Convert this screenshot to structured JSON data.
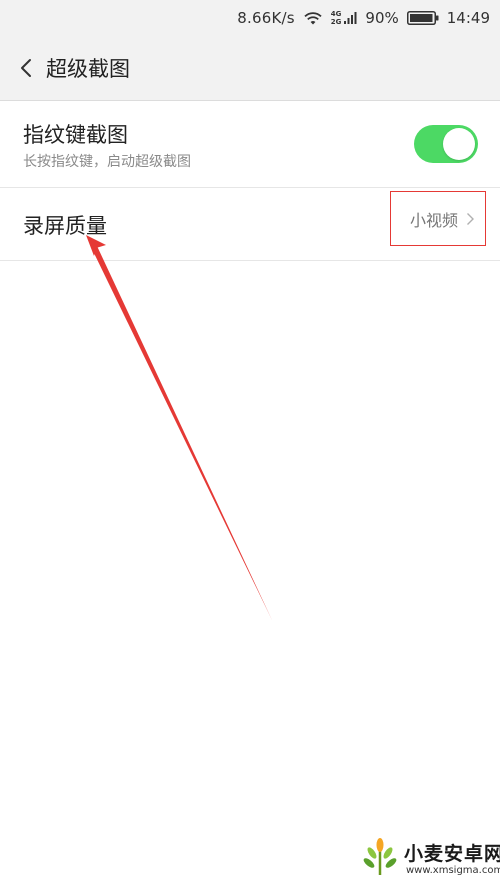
{
  "status_bar": {
    "net_speed": "8.66K/s",
    "net_type_top": "4G",
    "net_type_bottom": "2G",
    "battery": "90%",
    "time": "14:49"
  },
  "header": {
    "title": "超级截图"
  },
  "settings": {
    "fingerprint": {
      "title": "指纹键截图",
      "subtitle": "长按指纹键，启动超级截图",
      "enabled": true
    },
    "record_quality": {
      "title": "录屏质量",
      "value": "小视频"
    }
  },
  "watermark": {
    "brand": "小麦安卓网",
    "url": "www.xmsigma.com"
  },
  "colors": {
    "toggle_on": "#4cd964",
    "highlight_box": "#e53935",
    "arrow": "#e53935",
    "header_bg": "#f2f2f2"
  },
  "icons": {
    "back": "chevron-left-icon",
    "wifi": "wifi-icon",
    "signal": "signal-icon",
    "battery": "battery-icon",
    "row_chevron": "chevron-right-icon"
  }
}
